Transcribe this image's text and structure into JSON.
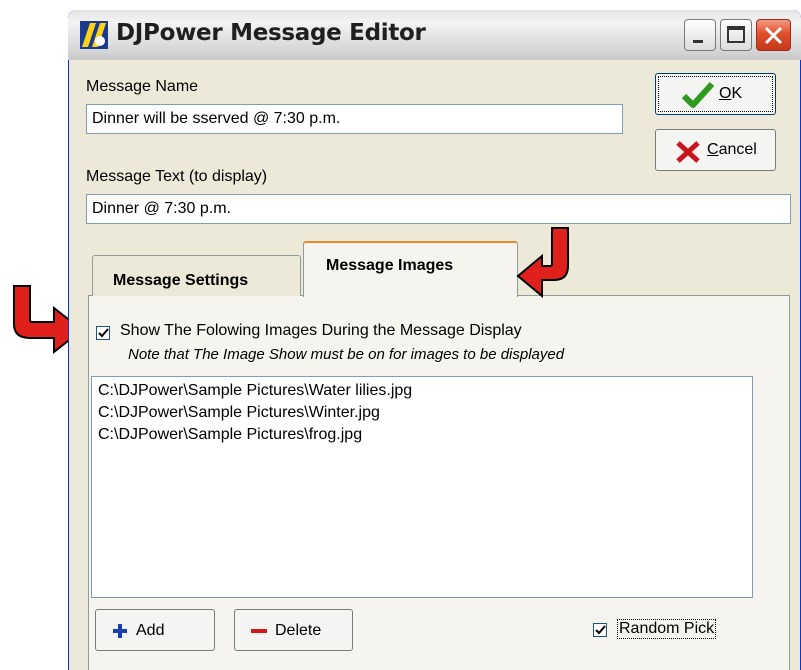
{
  "window": {
    "title": "DJPower Message Editor"
  },
  "form": {
    "message_name_label": "Message Name",
    "message_name_value": "Dinner will be sserved @ 7:30 p.m.",
    "message_text_label": "Message Text (to display)",
    "message_text_value": "Dinner @ 7:30 p.m."
  },
  "buttons": {
    "ok_mnemonic": "O",
    "ok_rest": "K",
    "cancel_mnemonic": "C",
    "cancel_rest": "ancel",
    "add_label": "Add",
    "delete_label": "Delete"
  },
  "tabs": [
    {
      "label": "Message Settings",
      "active": false
    },
    {
      "label": "Message Images",
      "active": true
    }
  ],
  "images_panel": {
    "show_images_label": "Show The Folowing Images During the Message Display",
    "show_images_checked": true,
    "note": "Note that The Image Show must be on for images to be displayed",
    "images": [
      "C:\\DJPower\\Sample Pictures\\Water lilies.jpg",
      "C:\\DJPower\\Sample Pictures\\Winter.jpg",
      "C:\\DJPower\\Sample Pictures\\frog.jpg"
    ],
    "random_pick_label": "Random Pick",
    "random_pick_checked": true
  },
  "colors": {
    "window_bg": "#ece9d8",
    "arrow_red": "#e0201a",
    "ok_check": "#2e9b1f",
    "cancel_x": "#c8141c",
    "add_plus": "#1a3fae",
    "delete_minus": "#d21a1a"
  },
  "icons": [
    "app-icon",
    "minimize-icon",
    "maximize-icon",
    "close-icon",
    "checkmark-icon",
    "x-icon",
    "plus-icon",
    "minus-icon",
    "curved-arrow-icon"
  ]
}
